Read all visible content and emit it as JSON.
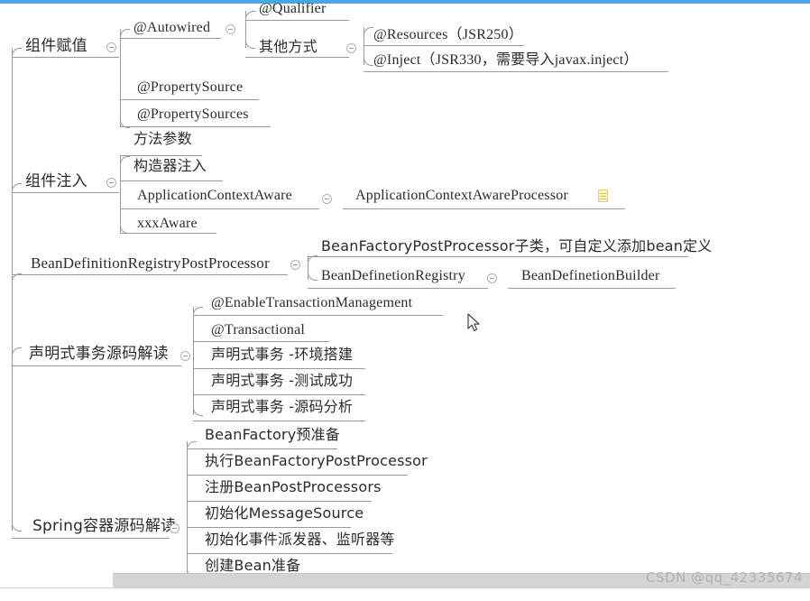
{
  "app": {
    "accent_color": "#4aa8dd",
    "line_color": "#9a9a9a",
    "text_color": "#2b2b2b"
  },
  "watermark": {
    "text": "CSDN @qq_42335674"
  },
  "mindmap": {
    "branches": [
      {
        "id": "component-assignment",
        "label": "组件赋值",
        "children": [
          {
            "id": "autowired",
            "label": "@Autowired",
            "children": [
              {
                "id": "qualifier",
                "label": "@Qualifier"
              },
              {
                "id": "other-ways",
                "label": "其他方式",
                "children": [
                  {
                    "id": "resources",
                    "label": "@Resources（JSR250）"
                  },
                  {
                    "id": "inject",
                    "label": "@Inject（JSR330，需要导入javax.inject）"
                  }
                ]
              }
            ]
          },
          {
            "id": "propertysource",
            "label": "@PropertySource"
          },
          {
            "id": "propertysources",
            "label": "@PropertySources"
          }
        ]
      },
      {
        "id": "component-injection",
        "label": "组件注入",
        "children": [
          {
            "id": "method-params",
            "label": "方法参数"
          },
          {
            "id": "constructor-injection",
            "label": "构造器注入"
          },
          {
            "id": "applicationcontextaware",
            "label": "ApplicationContextAware",
            "children": [
              {
                "id": "applicationcontextawareprocessor",
                "label": "ApplicationContextAwareProcessor",
                "note": true
              }
            ]
          },
          {
            "id": "xxxaware",
            "label": "xxxAware"
          }
        ]
      },
      {
        "id": "beandefinitionregistrypostprocessor",
        "label": "BeanDefinitionRegistryPostProcessor",
        "children": [
          {
            "id": "bfpp-subclass",
            "label": "BeanFactoryPostProcessor子类，可自定义添加bean定义"
          },
          {
            "id": "beandefinetionregistry",
            "label": "BeanDefinetionRegistry",
            "children": [
              {
                "id": "beandefinetionbuilder",
                "label": "BeanDefinetionBuilder"
              }
            ]
          }
        ]
      },
      {
        "id": "declarative-transaction",
        "label": "声明式事务源码解读",
        "children": [
          {
            "id": "enabletransactionmanagement",
            "label": "@EnableTransactionManagement"
          },
          {
            "id": "transactional",
            "label": "@Transactional"
          },
          {
            "id": "tx-env",
            "label": "声明式事务 -环境搭建"
          },
          {
            "id": "tx-test",
            "label": "声明式事务 -测试成功"
          },
          {
            "id": "tx-source",
            "label": "声明式事务 -源码分析"
          }
        ]
      },
      {
        "id": "spring-container",
        "label": "Spring容器源码解读",
        "children": [
          {
            "id": "beanfactory-prepare",
            "label": "BeanFactory预准备"
          },
          {
            "id": "exec-bfpp",
            "label": "执行BeanFactoryPostProcessor"
          },
          {
            "id": "register-bpp",
            "label": "注册BeanPostProcessors"
          },
          {
            "id": "init-messagesource",
            "label": "初始化MessageSource"
          },
          {
            "id": "init-event",
            "label": "初始化事件派发器、监听器等"
          },
          {
            "id": "create-bean",
            "label": "创建Bean准备"
          }
        ]
      }
    ]
  }
}
